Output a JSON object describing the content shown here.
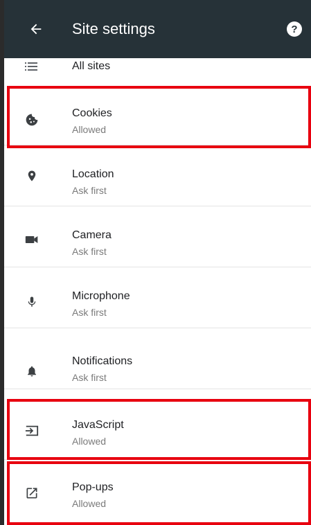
{
  "app_bar": {
    "title": "Site settings",
    "back_icon": "arrow-back-icon",
    "help_icon": "help-icon",
    "background": "#263238"
  },
  "all_sites": {
    "label": "All sites",
    "icon": "list-icon"
  },
  "items": [
    {
      "label": "Cookies",
      "status": "Allowed",
      "icon": "cookie-icon",
      "highlighted": true
    },
    {
      "label": "Location",
      "status": "Ask first",
      "icon": "location-pin-icon",
      "highlighted": false
    },
    {
      "label": "Camera",
      "status": "Ask first",
      "icon": "videocam-icon",
      "highlighted": false
    },
    {
      "label": "Microphone",
      "status": "Ask first",
      "icon": "microphone-icon",
      "highlighted": false
    },
    {
      "label": "Notifications",
      "status": "Ask first",
      "icon": "bell-icon",
      "highlighted": false
    },
    {
      "label": "JavaScript",
      "status": "Allowed",
      "icon": "javascript-icon",
      "highlighted": true
    },
    {
      "label": "Pop-ups",
      "status": "Allowed",
      "icon": "open-in-new-icon",
      "highlighted": true
    }
  ],
  "highlight_color": "#e8000f"
}
